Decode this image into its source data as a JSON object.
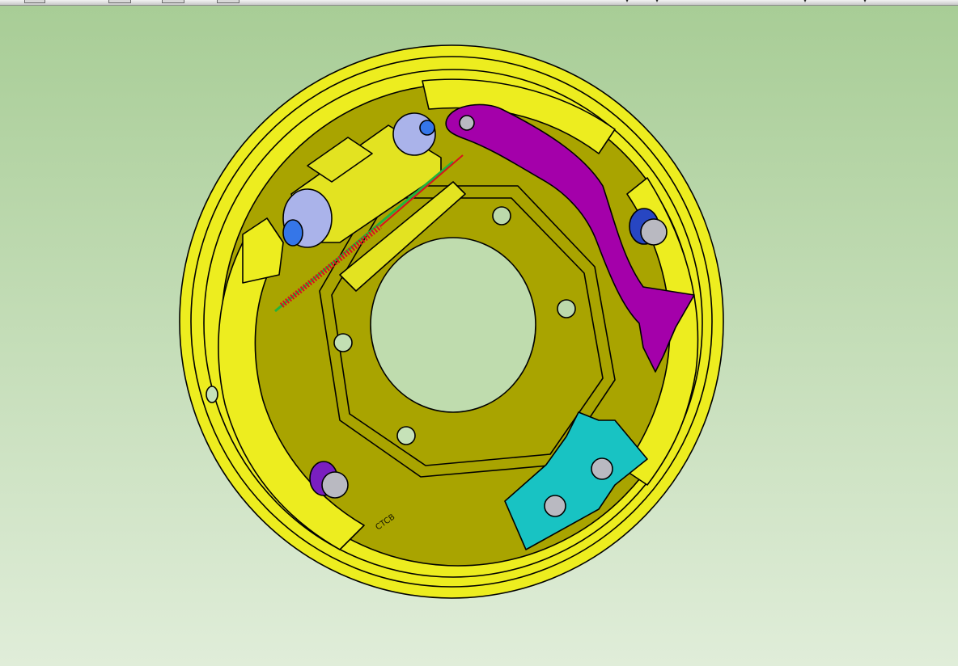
{
  "viewport": {
    "background_top": "#a8cd96",
    "background_bottom": "#e0edd9",
    "model": {
      "part_colors": {
        "backing_plate_light": "#eded1f",
        "backing_plate_dark": "#a9a400",
        "wheel_cylinder": "#e3e321",
        "piston_cap": "#aab3ea",
        "bleeder_tip": "#3576e8",
        "parking_lever": "#a400aa",
        "adjuster_bracket": "#18c3c3",
        "spring_red": "#d9121e",
        "spring_green": "#21b43c",
        "bolt_head": "#b9b9c1",
        "grommet_purple": "#7a1fc0",
        "grommet_blue": "#2746c2",
        "outline": "#000000"
      },
      "stamp_text": "CTCB"
    }
  }
}
